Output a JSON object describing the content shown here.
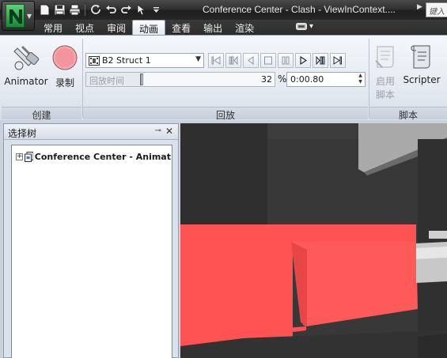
{
  "window": {
    "title": "Conference Center - Clash - ViewInContext....",
    "search_placeholder": "键入"
  },
  "tabs": [
    {
      "label": "常用",
      "active": false
    },
    {
      "label": "视点",
      "active": false
    },
    {
      "label": "审阅",
      "active": false
    },
    {
      "label": "动画",
      "active": true
    },
    {
      "label": "查看",
      "active": false
    },
    {
      "label": "输出",
      "active": false
    },
    {
      "label": "渲染",
      "active": false
    }
  ],
  "ribbon": {
    "create": {
      "label": "创建",
      "animator_label": "Animator",
      "record_label": "录制"
    },
    "playback": {
      "label": "回放",
      "animation_selected": "B2 Struct 1",
      "time_placeholder": "回放时间",
      "percent": "32",
      "percent_sign": "%",
      "time_value": "0:00.80"
    },
    "script": {
      "label": "脚本",
      "enable_line1": "启用",
      "enable_line2": "脚本",
      "scripter_label": "Scripter"
    }
  },
  "selection_tree": {
    "title": "选择树",
    "root_item": "Conference Center - Animat"
  },
  "colors": {
    "highlight_red": "#ff5252",
    "ribbon_bg": "#e2e8f0",
    "dark_frame": "#2e2e2e"
  }
}
